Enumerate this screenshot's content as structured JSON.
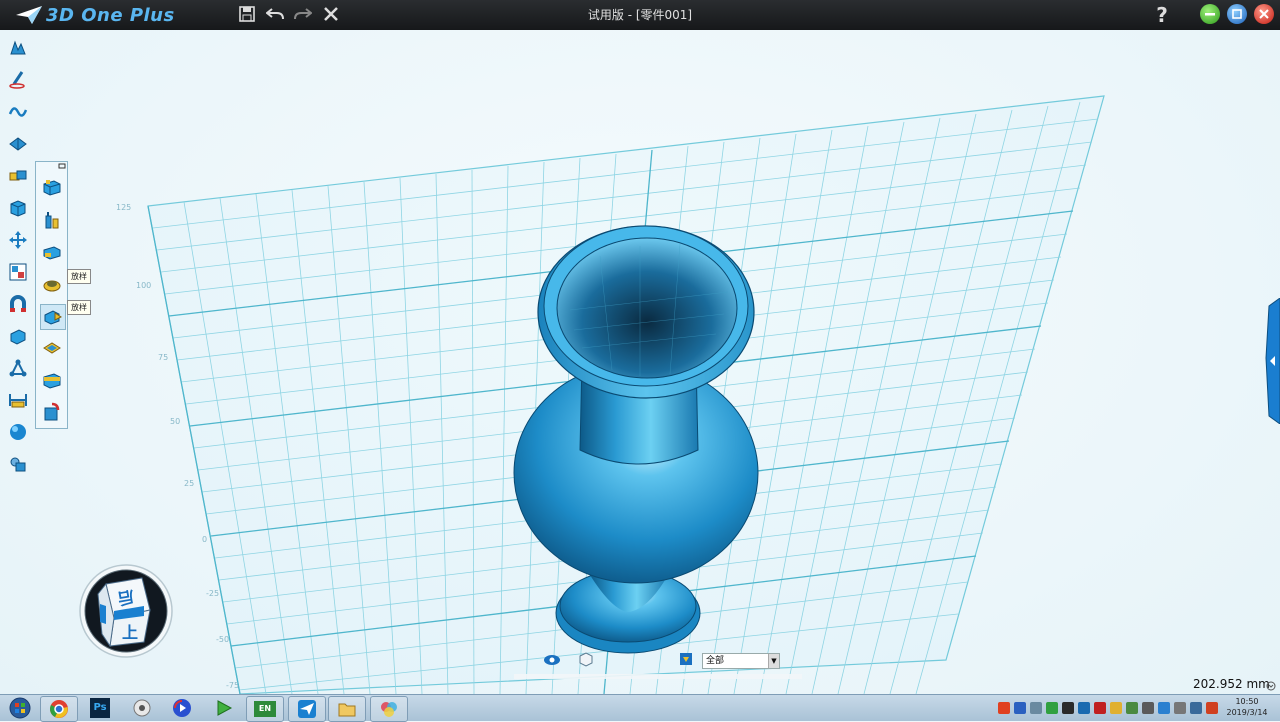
{
  "app": {
    "logo": "3D One Plus",
    "window_title": "试用版 - [零件001]",
    "help_label": "?"
  },
  "colors": {
    "accent": "#1e90d6",
    "model": "#2aa0d8",
    "grid": "#5fc3d6",
    "titlebar": "#1c1e20"
  },
  "quick_access": [
    "save-icon",
    "undo-icon",
    "redo-icon",
    "close-x-icon"
  ],
  "left_toolbar": [
    "basic-solid-icon",
    "sketch-icon",
    "curve-icon",
    "special-function-icon",
    "combine-icon",
    "feature-modeling-icon",
    "basic-edit-icon",
    "pattern-icon",
    "adsorb-icon",
    "assembly-icon",
    "distance-icon",
    "measure-icon",
    "render-sphere-icon",
    "material-icon"
  ],
  "sub_panel": [
    "extrude-icon",
    "revolve-icon",
    "sweep-icon",
    "loft-icon",
    "spin-icon",
    "shell-icon",
    "fillet-icon",
    "drill-icon"
  ],
  "tooltips": {
    "tip1": "放样",
    "tip2": "放样"
  },
  "grid_labels": [
    "125",
    "100",
    "75",
    "50",
    "25",
    "0",
    "-25",
    "-50",
    "-75"
  ],
  "view_cube": {
    "top_face": "上",
    "front_face": "后"
  },
  "bottom_bar": {
    "filter_value": "全部"
  },
  "status": {
    "distance": "202.952 mm"
  },
  "taskbar": {
    "apps": [
      "chrome",
      "photoshop",
      "media-player",
      "player",
      "en-input",
      "telegram",
      "folder",
      "color-app"
    ],
    "en_label": "EN",
    "ps_label": "Ps",
    "time": "10:50",
    "date": "2019/3/14"
  }
}
